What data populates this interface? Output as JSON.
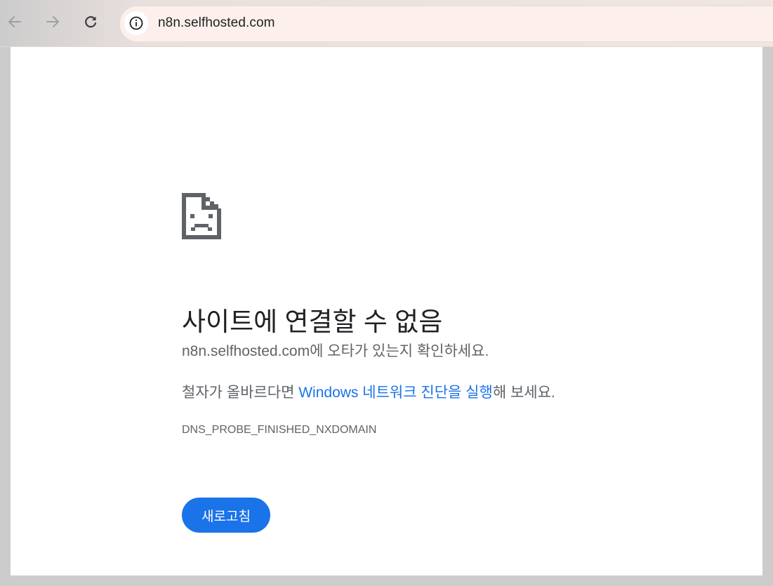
{
  "toolbar": {
    "back_icon": "arrow-left-icon",
    "forward_icon": "arrow-right-icon",
    "reload_icon": "reload-icon",
    "site_info_icon": "info-icon",
    "url": "n8n.selfhosted.com"
  },
  "error_page": {
    "icon": "sad-document-icon",
    "title": "사이트에 연결할 수 없음",
    "check_domain": "n8n.selfhosted.com",
    "check_suffix": "에 오타가 있는지 확인하세요.",
    "spelling_prefix": "철자가 올바르다면 ",
    "diagnostics_link": "Windows 네트워크 진단을 실행",
    "spelling_suffix": "해 보세요.",
    "error_code": "DNS_PROBE_FINISHED_NXDOMAIN",
    "reload_button": "새로고침"
  },
  "colors": {
    "accent": "#1a73e8",
    "text_primary": "#202124",
    "text_secondary": "#5f6368",
    "frame": "#cccccc"
  }
}
